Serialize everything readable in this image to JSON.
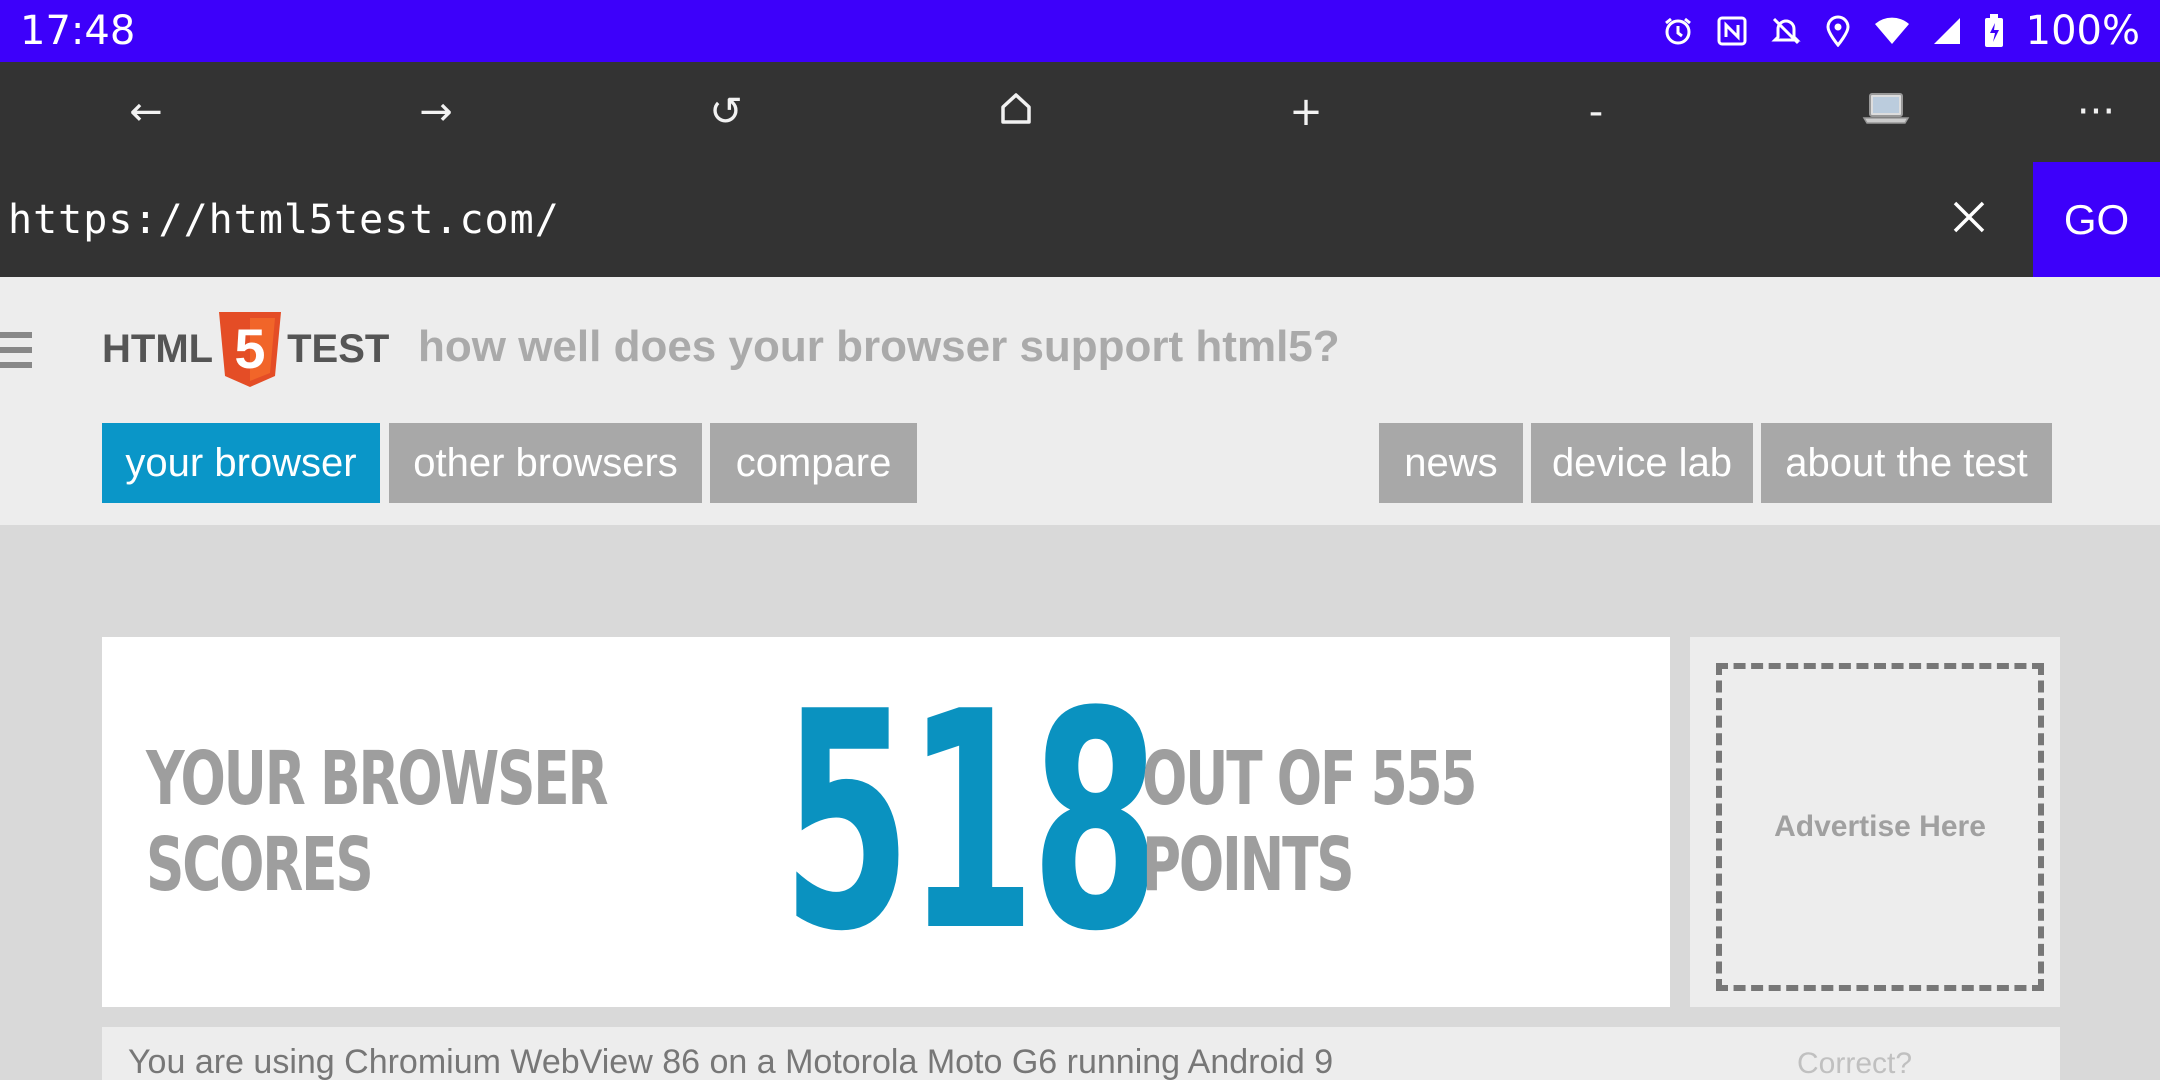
{
  "status_bar": {
    "time": "17:48",
    "battery": "100%",
    "icons": [
      "alarm-icon",
      "nfc-icon",
      "notifications-off-icon",
      "location-icon",
      "wifi-icon",
      "signal-icon",
      "battery-icon"
    ]
  },
  "toolbar": {
    "back": "←",
    "forward": "→",
    "reload": "↺",
    "home": "⌂",
    "zoom_in": "+",
    "zoom_out": "-",
    "desktop": "💻",
    "more": "···"
  },
  "url_bar": {
    "url": "https://html5test.com/",
    "clear": "✕",
    "go": "GO"
  },
  "site": {
    "logo_left": "HTML",
    "logo_number": "5",
    "logo_right": "TEST",
    "tagline": "how well does your browser support html5?",
    "nav": [
      {
        "label": "your browser",
        "active": true
      },
      {
        "label": "other browsers",
        "active": false
      },
      {
        "label": "compare",
        "active": false
      },
      {
        "label": "news",
        "active": false
      },
      {
        "label": "device lab",
        "active": false
      },
      {
        "label": "about the test",
        "active": false
      }
    ]
  },
  "score": {
    "prefix": "YOUR BROWSER SCORES",
    "value": "518",
    "suffix": "OUT OF 555 POINTS"
  },
  "ad": {
    "label": "Advertise Here"
  },
  "info": {
    "text": "You are using Chromium WebView 86 on a Motorola Moto G6 running Android 9",
    "correct": "Correct?"
  },
  "colors": {
    "status_bar": "#3d00fa",
    "toolbar": "#333333",
    "nav_active": "#0a96c8",
    "nav_inactive": "#a8a8a8",
    "score_number": "#0a92c0"
  }
}
